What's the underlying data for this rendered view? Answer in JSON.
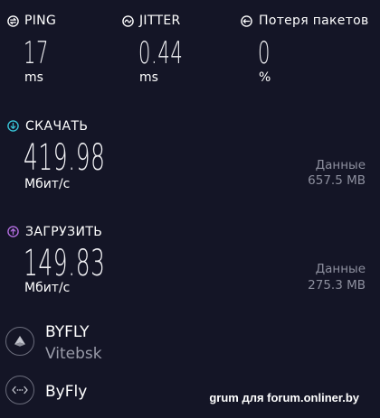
{
  "ping": {
    "label": "PING",
    "value": "17",
    "unit": "ms",
    "icon": "ping-icon"
  },
  "jitter": {
    "label": "JITTER",
    "value": "0.44",
    "unit": "ms",
    "icon": "jitter-icon"
  },
  "packet_loss": {
    "label": "Потеря пакетов",
    "value": "0",
    "unit": "%",
    "icon": "packet-loss-icon"
  },
  "download": {
    "label": "СКАЧАТЬ",
    "value": "419.98",
    "unit": "Мбит/с",
    "data_label": "Данные",
    "data_value": "657.5 MB",
    "icon": "download-arrow-icon",
    "accent": "#38c3d6"
  },
  "upload": {
    "label": "ЗАГРУЗИТЬ",
    "value": "149.83",
    "unit": "Мбит/с",
    "data_label": "Данные",
    "data_value": "275.3 MB",
    "icon": "upload-arrow-icon",
    "accent": "#b36ee0"
  },
  "server": {
    "host": "BYFLY",
    "location": "Vitebsk",
    "icon": "server-host-icon"
  },
  "provider": {
    "name": "ByFly",
    "icon": "provider-connection-icon"
  },
  "watermark": "grum для forum.onliner.by",
  "colors": {
    "background": "#141526",
    "text": "#ffffff",
    "muted": "#8d8f9e"
  }
}
